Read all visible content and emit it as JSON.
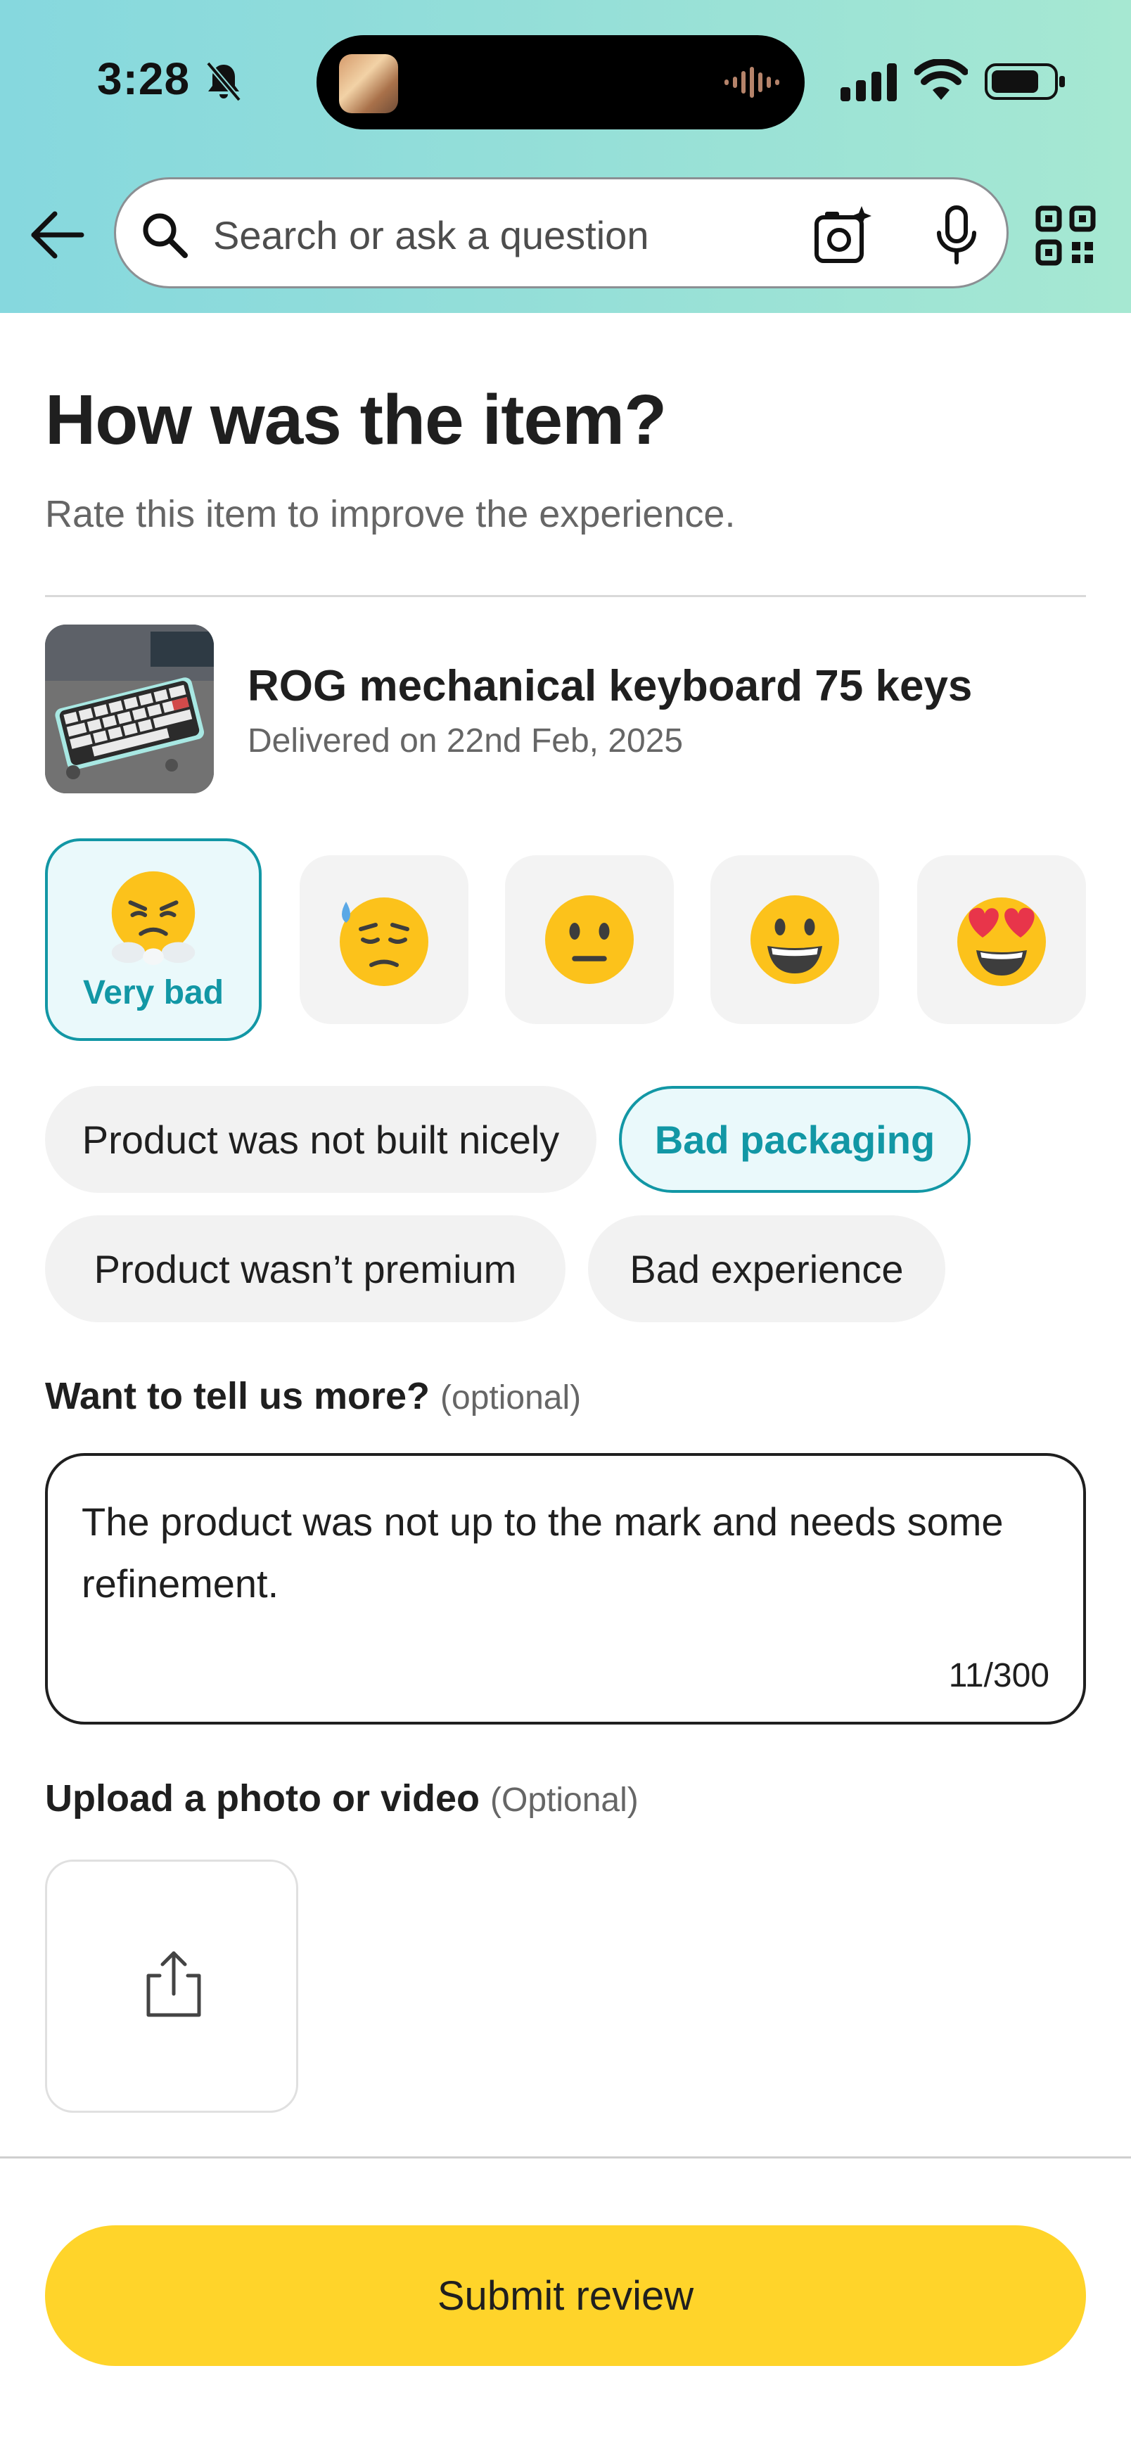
{
  "status_bar": {
    "time": "3:28"
  },
  "search": {
    "placeholder": "Search or ask a question"
  },
  "page": {
    "title": "How was the item?",
    "subtitle": "Rate this item to improve the experience."
  },
  "product": {
    "name": "ROG mechanical keyboard 75 keys",
    "delivered": "Delivered on 22nd Feb, 2025"
  },
  "rating": {
    "selected_label": "Very bad",
    "options": [
      "very-bad",
      "bad",
      "neutral",
      "good",
      "love"
    ]
  },
  "tags": [
    {
      "label": "Product was not built nicely",
      "selected": false
    },
    {
      "label": "Bad packaging",
      "selected": true
    },
    {
      "label": "Product wasn’t premium",
      "selected": false
    },
    {
      "label": "Bad experience",
      "selected": false
    }
  ],
  "feedback": {
    "label": "Want to tell us more?",
    "optional": "(optional)",
    "value": "The product was not up to the mark and needs some refinement.",
    "count": "11/300"
  },
  "upload": {
    "label": "Upload a photo or video",
    "optional": "(Optional)"
  },
  "submit_label": "Submit review",
  "colors": {
    "accent": "#1297a5",
    "submit": "#ffd42a",
    "header_start": "#86d8de",
    "header_end": "#a6e8d2"
  }
}
